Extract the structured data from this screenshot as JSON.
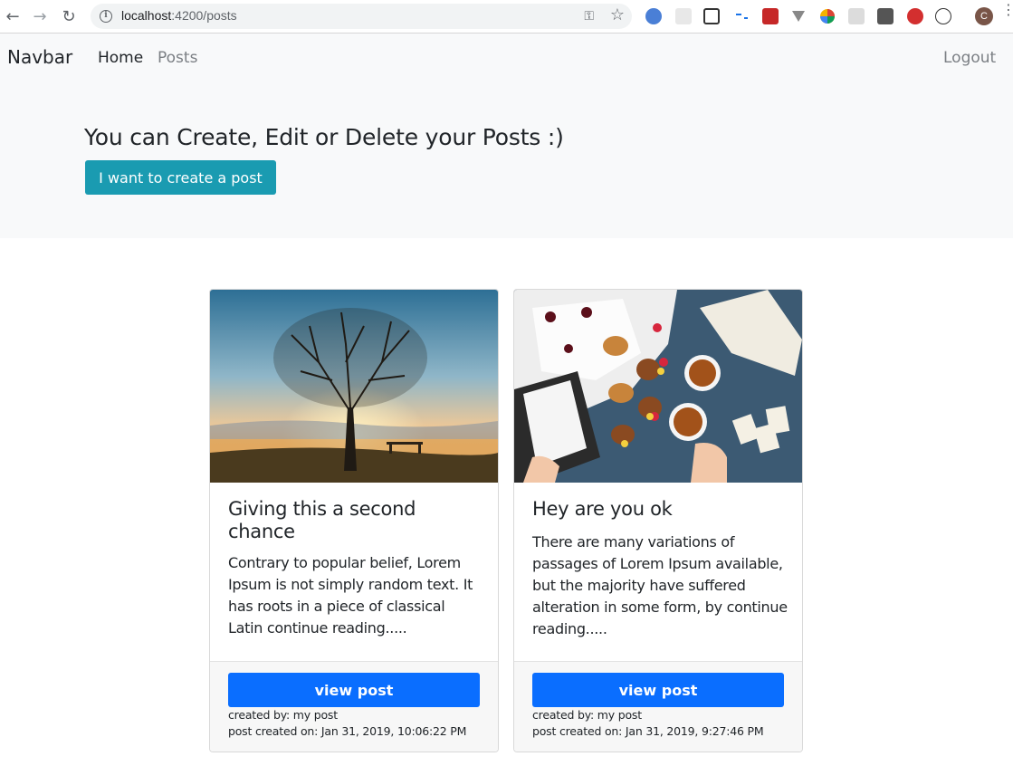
{
  "browser": {
    "url_host": "localhost",
    "url_path": ":4200/posts",
    "profile_initial": "C"
  },
  "navbar": {
    "brand": "Navbar",
    "links": [
      {
        "label": "Home"
      },
      {
        "label": "Posts"
      }
    ],
    "logout_label": "Logout"
  },
  "jumbotron": {
    "title": "You can Create, Edit or Delete your Posts :)",
    "button_label": "I want to create a post"
  },
  "posts": [
    {
      "title": "Giving this a second chance",
      "body": "Contrary to popular belief, Lorem Ipsum is not simply random text. It has roots in a piece of classical Latin continue reading.....",
      "button_label": "view post",
      "created_by": "created by: my post",
      "created_on": "post created on: Jan 31, 2019, 10:06:22 PM"
    },
    {
      "title": "Hey are you ok",
      "body": "There are many variations of passages of Lorem Ipsum available, but the majority have suffered alteration in some form, by continue reading.....",
      "button_label": "view post",
      "created_by": "created by: my post",
      "created_on": "post created on: Jan 31, 2019, 9:27:46 PM"
    }
  ],
  "colors": {
    "primary": "#0a6eff",
    "info": "#1a9bb1",
    "nav_bg": "#f8f9fa"
  }
}
